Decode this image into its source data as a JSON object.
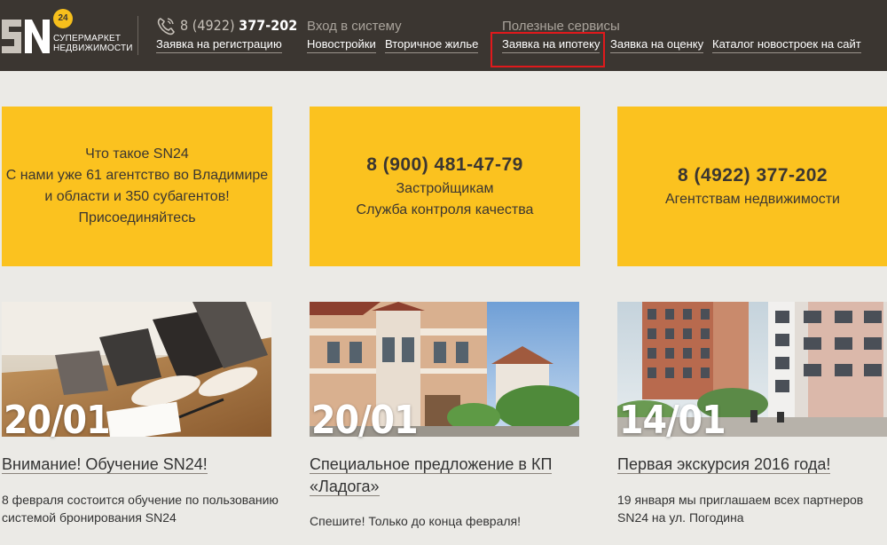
{
  "header": {
    "logo": {
      "badge": "24",
      "line1": "СУПЕРМАРКЕТ",
      "line2": "НЕДВИЖИМОСТИ"
    },
    "phone": {
      "code": "8 (4922)",
      "number": "377-202"
    },
    "register_link": "Заявка на регистрацию",
    "login_caption": "Вход в систему",
    "login_links": [
      "Новостройки",
      "Вторичное жилье"
    ],
    "services_caption": "Полезные сервисы",
    "services_links": [
      "Заявка на ипотеку",
      "Заявка на оценку",
      "Каталог новостроек на сайт"
    ]
  },
  "promo": [
    {
      "lines": [
        "Что такое SN24",
        "С нами уже 61 агентство во Владимире",
        "и области и 350 субагентов!",
        "Присоединяйтесь"
      ]
    },
    {
      "phone": "8 (900) 481-47-79",
      "lines": [
        "Застройщикам",
        "Служба контроля качества"
      ]
    },
    {
      "phone": "8 (4922) 377-202",
      "lines": [
        "Агентствам недвижимости"
      ]
    }
  ],
  "news": [
    {
      "date": "20/01",
      "title": "Внимание! Обучение SN24!",
      "text_lines": [
        "8 февраля состоится обучение по пользованию",
        "системой бронирования SN24"
      ]
    },
    {
      "date": "20/01",
      "title_lines": [
        "Специальное предложение в КП",
        "«Ладога»"
      ],
      "text_lines": [
        "Спешите! Только до конца февраля!"
      ]
    },
    {
      "date": "14/01",
      "title": "Первая экскурсия 2016 года!",
      "text_lines": [
        "19 января мы приглашаем всех партнеров",
        "SN24 на ул. Погодина"
      ]
    }
  ],
  "colors": {
    "header_bg": "#3b3631",
    "accent": "#fbc21f",
    "page_bg": "#ebeae6",
    "highlight": "#e0191c"
  }
}
